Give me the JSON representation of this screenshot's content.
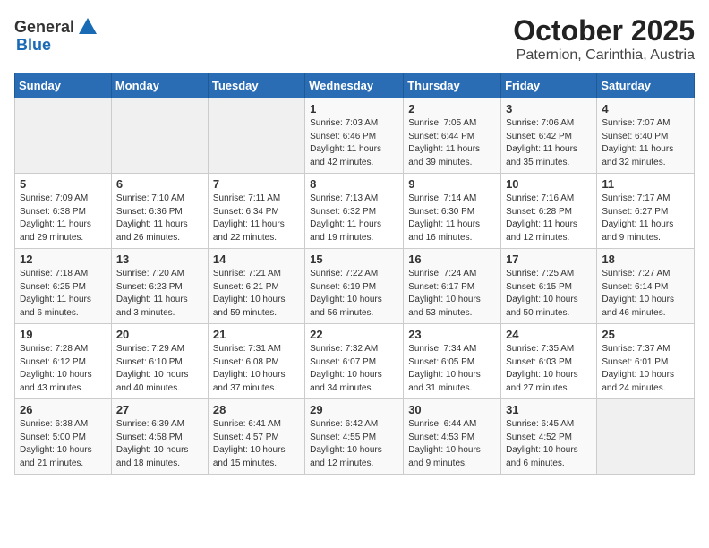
{
  "header": {
    "logo_general": "General",
    "logo_blue": "Blue",
    "title": "October 2025",
    "subtitle": "Paternion, Carinthia, Austria"
  },
  "calendar": {
    "weekdays": [
      "Sunday",
      "Monday",
      "Tuesday",
      "Wednesday",
      "Thursday",
      "Friday",
      "Saturday"
    ],
    "weeks": [
      [
        {
          "day": "",
          "info": ""
        },
        {
          "day": "",
          "info": ""
        },
        {
          "day": "",
          "info": ""
        },
        {
          "day": "1",
          "info": "Sunrise: 7:03 AM\nSunset: 6:46 PM\nDaylight: 11 hours\nand 42 minutes."
        },
        {
          "day": "2",
          "info": "Sunrise: 7:05 AM\nSunset: 6:44 PM\nDaylight: 11 hours\nand 39 minutes."
        },
        {
          "day": "3",
          "info": "Sunrise: 7:06 AM\nSunset: 6:42 PM\nDaylight: 11 hours\nand 35 minutes."
        },
        {
          "day": "4",
          "info": "Sunrise: 7:07 AM\nSunset: 6:40 PM\nDaylight: 11 hours\nand 32 minutes."
        }
      ],
      [
        {
          "day": "5",
          "info": "Sunrise: 7:09 AM\nSunset: 6:38 PM\nDaylight: 11 hours\nand 29 minutes."
        },
        {
          "day": "6",
          "info": "Sunrise: 7:10 AM\nSunset: 6:36 PM\nDaylight: 11 hours\nand 26 minutes."
        },
        {
          "day": "7",
          "info": "Sunrise: 7:11 AM\nSunset: 6:34 PM\nDaylight: 11 hours\nand 22 minutes."
        },
        {
          "day": "8",
          "info": "Sunrise: 7:13 AM\nSunset: 6:32 PM\nDaylight: 11 hours\nand 19 minutes."
        },
        {
          "day": "9",
          "info": "Sunrise: 7:14 AM\nSunset: 6:30 PM\nDaylight: 11 hours\nand 16 minutes."
        },
        {
          "day": "10",
          "info": "Sunrise: 7:16 AM\nSunset: 6:28 PM\nDaylight: 11 hours\nand 12 minutes."
        },
        {
          "day": "11",
          "info": "Sunrise: 7:17 AM\nSunset: 6:27 PM\nDaylight: 11 hours\nand 9 minutes."
        }
      ],
      [
        {
          "day": "12",
          "info": "Sunrise: 7:18 AM\nSunset: 6:25 PM\nDaylight: 11 hours\nand 6 minutes."
        },
        {
          "day": "13",
          "info": "Sunrise: 7:20 AM\nSunset: 6:23 PM\nDaylight: 11 hours\nand 3 minutes."
        },
        {
          "day": "14",
          "info": "Sunrise: 7:21 AM\nSunset: 6:21 PM\nDaylight: 10 hours\nand 59 minutes."
        },
        {
          "day": "15",
          "info": "Sunrise: 7:22 AM\nSunset: 6:19 PM\nDaylight: 10 hours\nand 56 minutes."
        },
        {
          "day": "16",
          "info": "Sunrise: 7:24 AM\nSunset: 6:17 PM\nDaylight: 10 hours\nand 53 minutes."
        },
        {
          "day": "17",
          "info": "Sunrise: 7:25 AM\nSunset: 6:15 PM\nDaylight: 10 hours\nand 50 minutes."
        },
        {
          "day": "18",
          "info": "Sunrise: 7:27 AM\nSunset: 6:14 PM\nDaylight: 10 hours\nand 46 minutes."
        }
      ],
      [
        {
          "day": "19",
          "info": "Sunrise: 7:28 AM\nSunset: 6:12 PM\nDaylight: 10 hours\nand 43 minutes."
        },
        {
          "day": "20",
          "info": "Sunrise: 7:29 AM\nSunset: 6:10 PM\nDaylight: 10 hours\nand 40 minutes."
        },
        {
          "day": "21",
          "info": "Sunrise: 7:31 AM\nSunset: 6:08 PM\nDaylight: 10 hours\nand 37 minutes."
        },
        {
          "day": "22",
          "info": "Sunrise: 7:32 AM\nSunset: 6:07 PM\nDaylight: 10 hours\nand 34 minutes."
        },
        {
          "day": "23",
          "info": "Sunrise: 7:34 AM\nSunset: 6:05 PM\nDaylight: 10 hours\nand 31 minutes."
        },
        {
          "day": "24",
          "info": "Sunrise: 7:35 AM\nSunset: 6:03 PM\nDaylight: 10 hours\nand 27 minutes."
        },
        {
          "day": "25",
          "info": "Sunrise: 7:37 AM\nSunset: 6:01 PM\nDaylight: 10 hours\nand 24 minutes."
        }
      ],
      [
        {
          "day": "26",
          "info": "Sunrise: 6:38 AM\nSunset: 5:00 PM\nDaylight: 10 hours\nand 21 minutes."
        },
        {
          "day": "27",
          "info": "Sunrise: 6:39 AM\nSunset: 4:58 PM\nDaylight: 10 hours\nand 18 minutes."
        },
        {
          "day": "28",
          "info": "Sunrise: 6:41 AM\nSunset: 4:57 PM\nDaylight: 10 hours\nand 15 minutes."
        },
        {
          "day": "29",
          "info": "Sunrise: 6:42 AM\nSunset: 4:55 PM\nDaylight: 10 hours\nand 12 minutes."
        },
        {
          "day": "30",
          "info": "Sunrise: 6:44 AM\nSunset: 4:53 PM\nDaylight: 10 hours\nand 9 minutes."
        },
        {
          "day": "31",
          "info": "Sunrise: 6:45 AM\nSunset: 4:52 PM\nDaylight: 10 hours\nand 6 minutes."
        },
        {
          "day": "",
          "info": ""
        }
      ]
    ]
  }
}
